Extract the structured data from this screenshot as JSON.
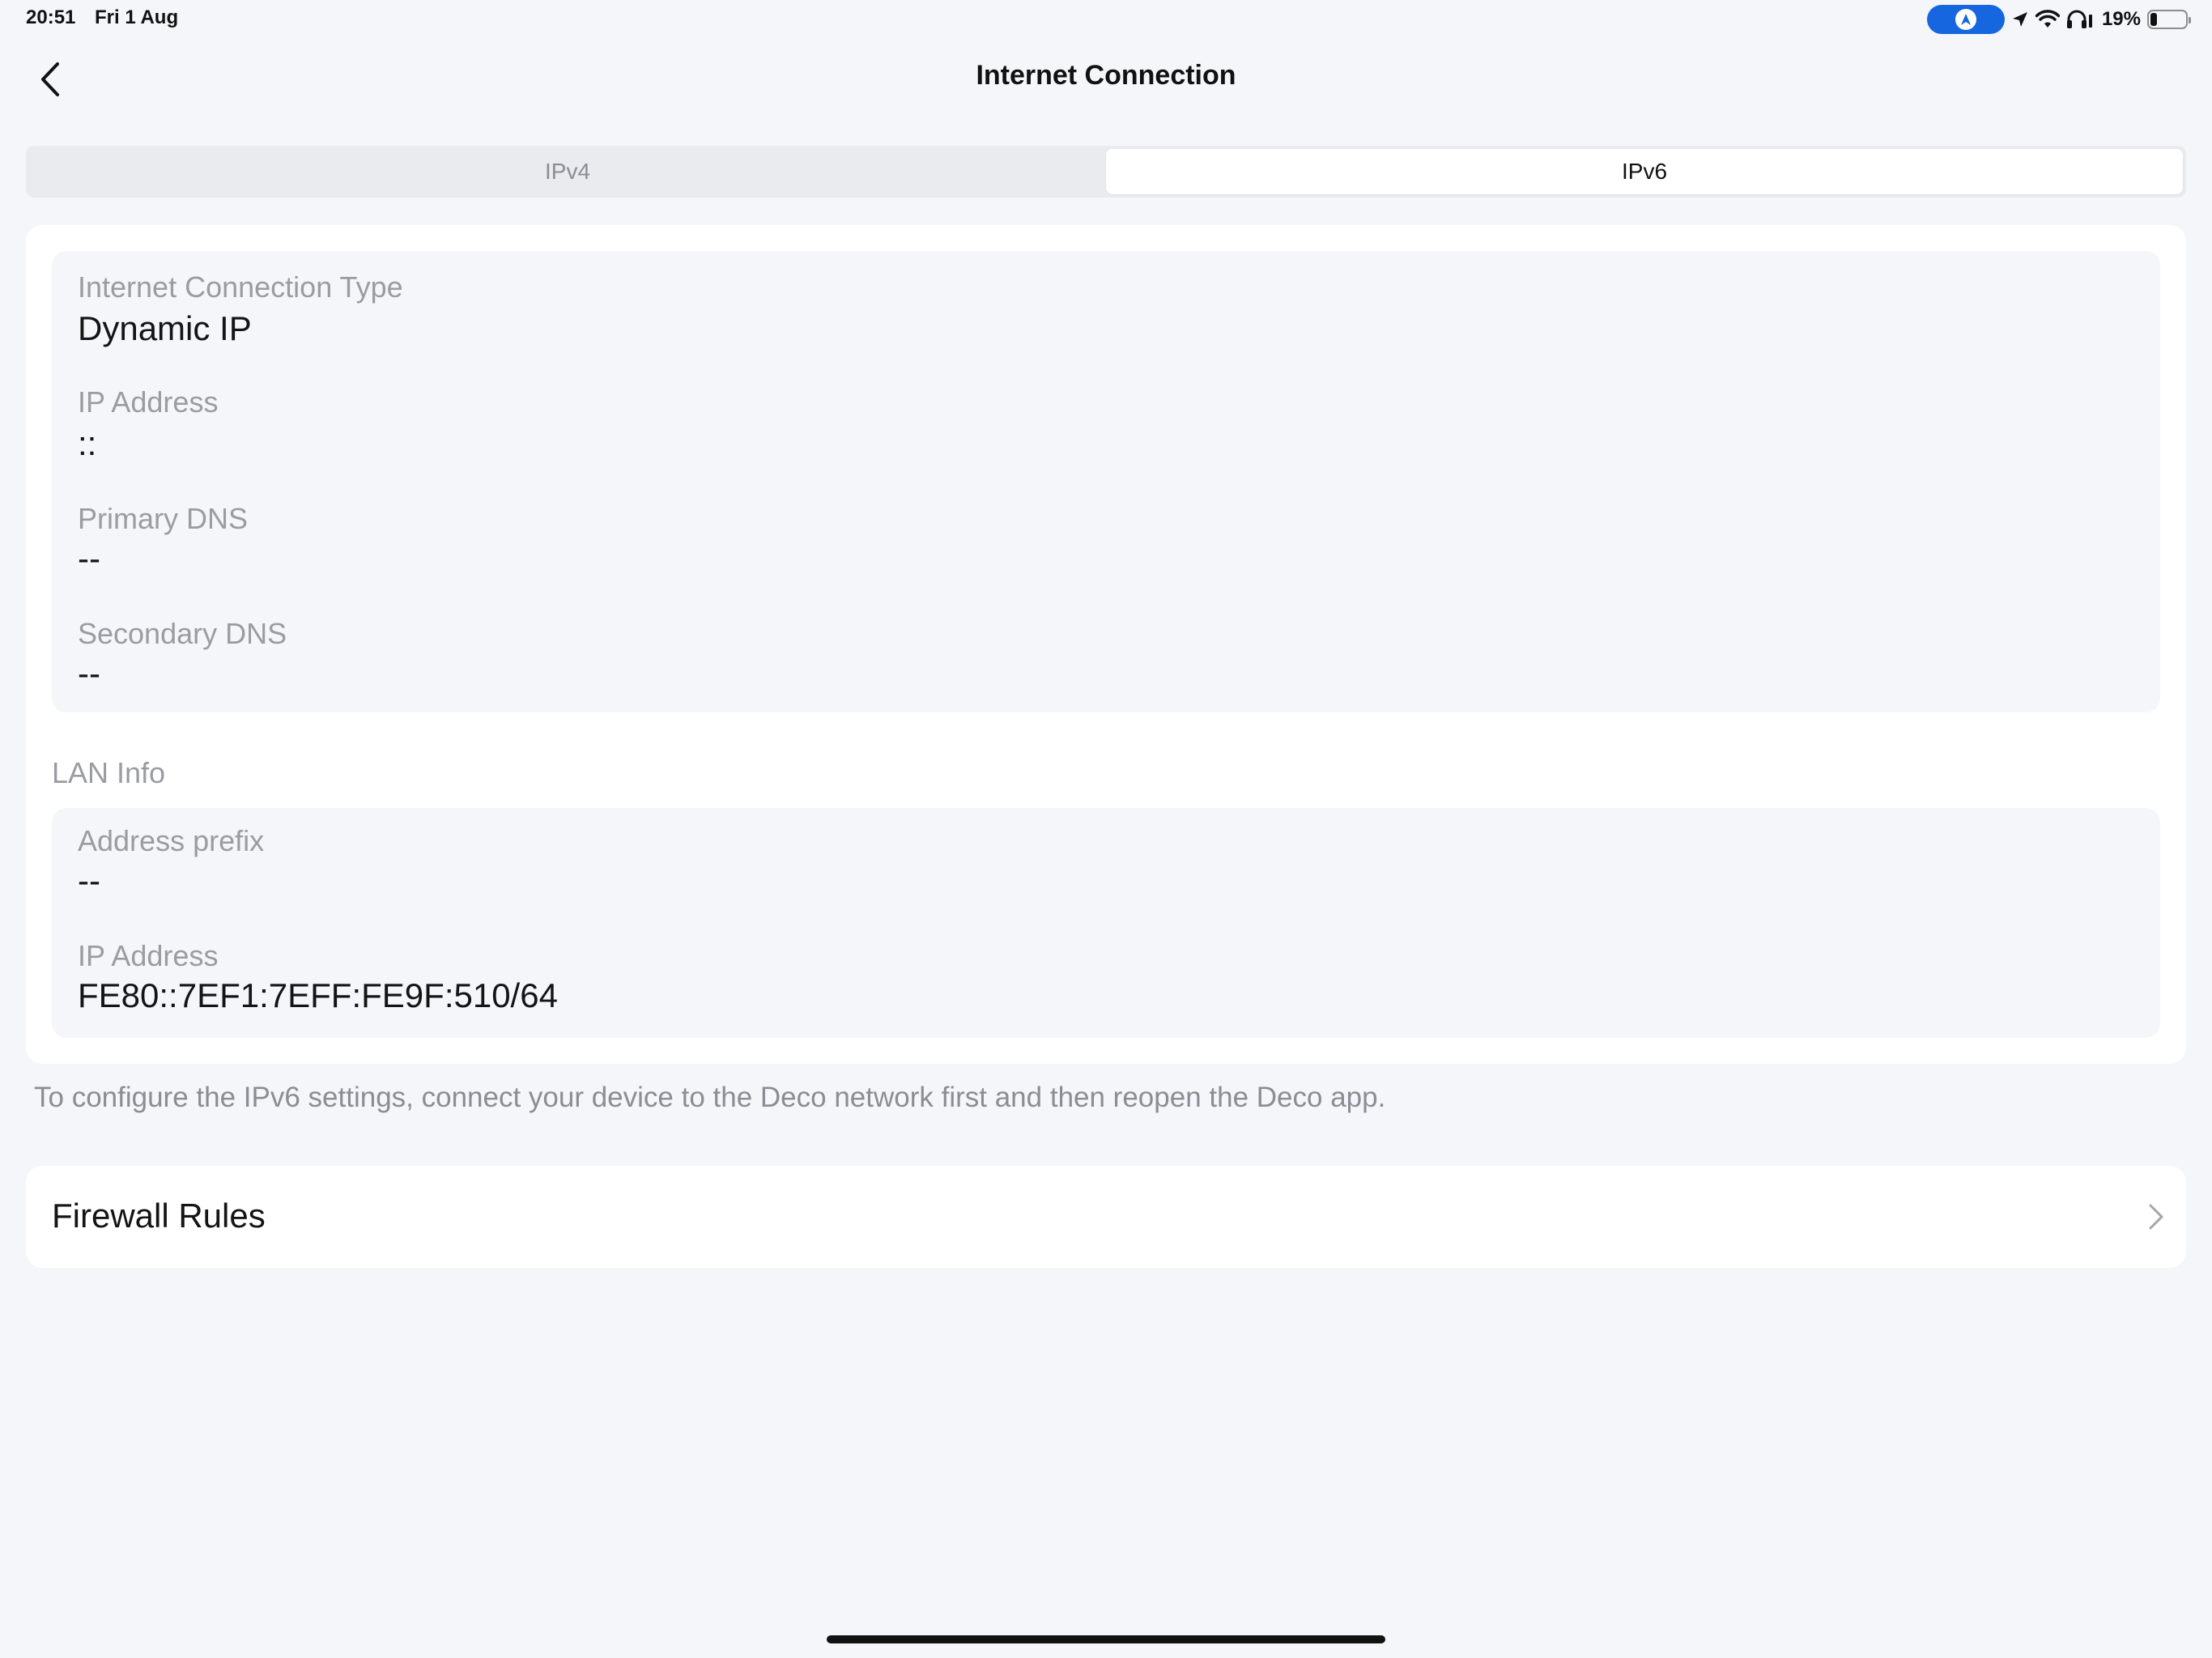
{
  "status_bar": {
    "time": "20:51",
    "date": "Fri 1 Aug",
    "battery_percent_label": "19%",
    "battery_level": 0.19,
    "icons": [
      "navigation-pill-icon",
      "location-arrow-icon",
      "wifi-icon",
      "headphones-icon",
      "battery-icon"
    ],
    "accent_color": "#1666e0"
  },
  "nav": {
    "title": "Internet Connection",
    "back_icon": "chevron-left-icon"
  },
  "tabs": {
    "items": [
      {
        "label": "IPv4",
        "selected": false
      },
      {
        "label": "IPv6",
        "selected": true
      }
    ]
  },
  "wan": {
    "fields": [
      {
        "label": "Internet Connection Type",
        "value": "Dynamic IP"
      },
      {
        "label": "IP Address",
        "value": "::"
      },
      {
        "label": "Primary DNS",
        "value": "--"
      },
      {
        "label": "Secondary DNS",
        "value": "--"
      }
    ]
  },
  "lan": {
    "header": "LAN Info",
    "fields": [
      {
        "label": "Address prefix",
        "value": "--"
      },
      {
        "label": "IP Address",
        "value": "FE80::7EF1:7EFF:FE9F:510/64"
      }
    ]
  },
  "note": "To configure the IPv6 settings, connect your device to the Deco network first and then reopen the Deco app.",
  "firewall": {
    "label": "Firewall Rules",
    "icon": "chevron-right-icon"
  }
}
